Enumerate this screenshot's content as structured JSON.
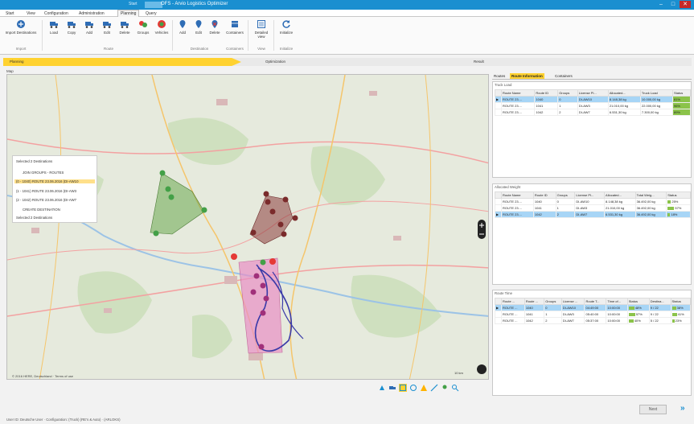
{
  "window": {
    "title": "OFS - Arvio Logistics Optimizer",
    "quick_access": "Start",
    "minimize": "–",
    "maximize": "□",
    "close": "✕"
  },
  "menu": [
    {
      "label": "Start"
    },
    {
      "label": "View"
    },
    {
      "label": "Configuration"
    },
    {
      "label": "Administration"
    },
    {
      "label": "Planning"
    },
    {
      "label": "Query"
    }
  ],
  "ribbon": {
    "groups": [
      {
        "label": "Import"
      },
      {
        "label": "Route"
      },
      {
        "label": "Destination"
      },
      {
        "label": "Containers"
      },
      {
        "label": "View"
      },
      {
        "label": "Initialize"
      }
    ],
    "buttons": [
      {
        "label": "Import Destinations",
        "icon": "import-icon",
        "color": "#2f6db5"
      },
      {
        "label": "Load",
        "icon": "truck-load-icon",
        "color": "#2f6db5"
      },
      {
        "label": "Copy",
        "icon": "truck-copy-icon",
        "color": "#2f6db5"
      },
      {
        "label": "Add",
        "icon": "truck-add-icon",
        "color": "#2f6db5"
      },
      {
        "label": "Edit",
        "icon": "truck-edit-icon",
        "color": "#2f6db5"
      },
      {
        "label": "Delete",
        "icon": "truck-delete-icon",
        "color": "#2f6db5"
      },
      {
        "label": "Groups",
        "icon": "groups-icon",
        "color": "#e53935"
      },
      {
        "label": "Vehicles",
        "icon": "vehicles-icon",
        "color": "#43a047"
      },
      {
        "label": "Add",
        "icon": "destination-add-icon",
        "color": "#2f6db5"
      },
      {
        "label": "Edit",
        "icon": "destination-edit-icon",
        "color": "#2f6db5"
      },
      {
        "label": "Delete",
        "icon": "destination-delete-icon",
        "color": "#2f6db5"
      },
      {
        "label": "Containers",
        "icon": "containers-icon",
        "color": "#2f6db5"
      },
      {
        "label": "Detailed view",
        "icon": "detailed-view-icon",
        "color": "#2f6db5"
      },
      {
        "label": "Initialize",
        "icon": "initialize-icon",
        "color": "#2f6db5"
      }
    ]
  },
  "workflow": {
    "steps": [
      "Planning",
      "Optimization",
      "Result"
    ],
    "active_color": "#ffd230"
  },
  "map": {
    "header": "Map",
    "legend": {
      "rows": [
        "Selected 2 Destinations",
        "JOIN GROUPS - ROUTES",
        "(0 - 1040) ROUTE 23.06.2016 (DI-AW10",
        "(1 - 1041) ROUTE 23.06.2016 (DI-AW3",
        "(2 - 1042) ROUTE 23.06.2016 (DI-AW7",
        "CREATE DESTINATION",
        "Selected 2 Destinations"
      ]
    },
    "copyright": "© 2016 HERE, Deutschland · Terms of use",
    "scale": "10 km",
    "colors": {
      "green": "#6aa84f",
      "brown": "#8b3a3a",
      "pink": "#e88fc4",
      "route": "#3a3aa8"
    }
  },
  "right": {
    "tabs": [
      "Routes",
      "Route Information",
      "Containers"
    ],
    "truck_load": {
      "title": "Truck Load",
      "headers": [
        "Route Name",
        "Route ID",
        "Groups",
        "License Pl...",
        "Allocated...",
        "Truck Load",
        "Status"
      ],
      "rows": [
        [
          "ROUTE 23....",
          "1040",
          "0",
          "DI-AW10",
          "8.148,38 kg",
          "10.000,00 kg",
          "81%"
        ],
        [
          "ROUTE 23....",
          "1041",
          "1",
          "DI-AW3",
          "21.010,00 kg",
          "22.000,00 kg",
          "96%"
        ],
        [
          "ROUTE 23....",
          "1042",
          "2",
          "DI-AW7",
          "6.531,30 kg",
          "7.300,00 kg",
          "89%"
        ]
      ]
    },
    "weight": {
      "title": "Allocated Weight",
      "headers": [
        "Route Name",
        "Route ID",
        "Groups",
        "License Pl...",
        "Allocated...",
        "Total Weig...",
        "Status"
      ],
      "rows": [
        [
          "ROUTE 23....",
          "1040",
          "0",
          "DI-AW10",
          "8.148,38 kg",
          "36.492,00 kg",
          "25%"
        ],
        [
          "ROUTE 23....",
          "1041",
          "1",
          "DI-AW3",
          "21.010,00 kg",
          "36.492,00 kg",
          "57%"
        ],
        [
          "ROUTE 23....",
          "1042",
          "2",
          "DI-AW7",
          "6.531,30 kg",
          "36.492,00 kg",
          "18%"
        ]
      ]
    },
    "time": {
      "title": "Route Time",
      "headers": [
        "Route ...",
        "Route ...",
        "Groups",
        "License ...",
        "Route T...",
        "Time of...",
        "Status",
        "Destina...",
        "Status"
      ],
      "rows": [
        [
          "ROUTE ...",
          "1040",
          "0",
          "DI-AW10",
          "04:49:00",
          "10:00:00",
          "48%",
          "9 / 22",
          "38%"
        ],
        [
          "ROUTE ...",
          "1041",
          "1",
          "DI-AW3",
          "05:40:00",
          "10:00:00",
          "57%",
          "9 / 22",
          "41%"
        ],
        [
          "ROUTE ...",
          "1042",
          "2",
          "DI-AW7",
          "05:37:00",
          "10:00:00",
          "40%",
          "5 / 22",
          "23%"
        ]
      ]
    }
  },
  "footer": {
    "next": "Next",
    "status": "User ID: Deutsche User · Configuration: (Truck) (RE's & Auto) · (ARLOKS)"
  }
}
